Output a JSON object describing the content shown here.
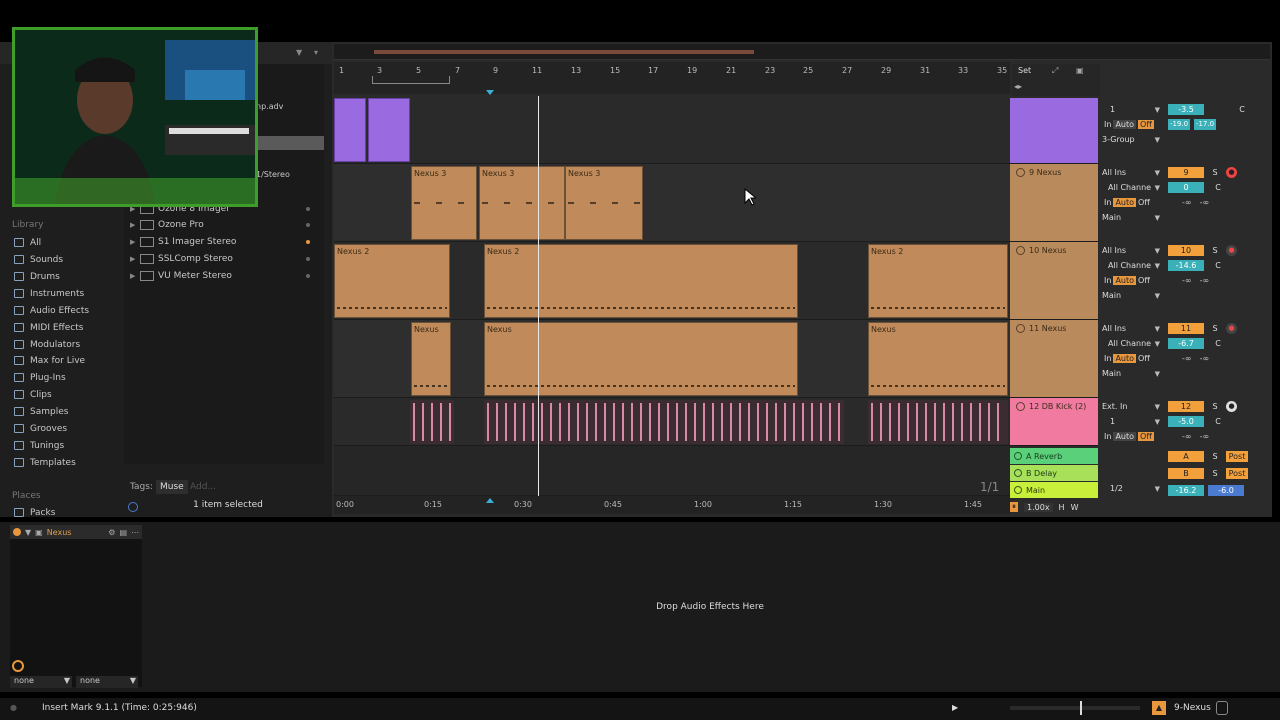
{
  "browser": {
    "file_fragments": {
      "advanced": "np.adv",
      "stereo": "1/Stereo"
    },
    "plugins": [
      {
        "label": "Ozone 8 Imager"
      },
      {
        "label": "Ozone Pro"
      },
      {
        "label": "S1 Imager Stereo"
      },
      {
        "label": "SSLComp Stereo"
      },
      {
        "label": "VU Meter Stereo"
      }
    ],
    "library_heading": "Library",
    "library_items": [
      "All",
      "Sounds",
      "Drums",
      "Instruments",
      "Audio Effects",
      "MIDI Effects",
      "Modulators",
      "Max for Live",
      "Plug-Ins",
      "Clips",
      "Samples",
      "Grooves",
      "Tunings",
      "Templates"
    ],
    "places_heading": "Places",
    "places_items": [
      "Packs"
    ],
    "tags_label": "Tags:",
    "tag_muse": "Muse",
    "tag_add": "Add...",
    "selection_status": "1 item selected"
  },
  "arrangement": {
    "bar_numbers": [
      "1",
      "3",
      "5",
      "7",
      "9",
      "11",
      "13",
      "15",
      "17",
      "19",
      "21",
      "23",
      "25",
      "27",
      "29",
      "31",
      "33",
      "35"
    ],
    "set_label": "Set",
    "time_labels": [
      "0:00",
      "0:15",
      "0:30",
      "0:45",
      "1:00",
      "1:15",
      "1:30",
      "1:45"
    ],
    "page_indicator": "1/1",
    "zoom_value": "1.00x",
    "h_label": "H",
    "w_label": "W"
  },
  "tracks": {
    "t8": {
      "io_sub": "1",
      "auto": "Auto",
      "off": "Off",
      "output": "3-Group",
      "vol": "-3.5",
      "vol2": "-19.0",
      "vol3": "-17.0",
      "pan": "C"
    },
    "t9": {
      "name": "9 Nexus",
      "input": "All Ins",
      "channel": "All Channe",
      "in": "In",
      "auto": "Auto",
      "off": "Off",
      "output": "Main",
      "num": "9",
      "solo": "S",
      "vol": "0",
      "pan": "C",
      "inf1": "-∞",
      "inf2": "-∞",
      "clip_label": "Nexus 3"
    },
    "t10": {
      "name": "10 Nexus",
      "input": "All Ins",
      "channel": "All Channe",
      "in": "In",
      "auto": "Auto",
      "off": "Off",
      "output": "Main",
      "num": "10",
      "solo": "S",
      "vol": "-14.6",
      "pan": "C",
      "inf1": "-∞",
      "inf2": "-∞",
      "clip_label": "Nexus 2"
    },
    "t11": {
      "name": "11 Nexus",
      "input": "All Ins",
      "channel": "All Channe",
      "in": "In",
      "auto": "Auto",
      "off": "Off",
      "output": "Main",
      "num": "11",
      "solo": "S",
      "vol": "-6.7",
      "pan": "C",
      "inf1": "-∞",
      "inf2": "-∞",
      "clip_label": "Nexus"
    },
    "t12": {
      "name": "12 DB Kick (2)",
      "input": "Ext. In",
      "sub": "1",
      "in": "In",
      "auto": "Auto",
      "off": "Off",
      "num": "12",
      "solo": "S",
      "vol": "-5.0",
      "pan": "C",
      "inf1": "-∞",
      "inf2": "-∞"
    },
    "returns": [
      {
        "name": "A Reverb",
        "num": "A",
        "solo": "S",
        "post": "Post",
        "color": "#5ad07a"
      },
      {
        "name": "B Delay",
        "num": "B",
        "solo": "S",
        "post": "Post",
        "color": "#a8e05a"
      }
    ],
    "main": {
      "name": "Main",
      "sub": "1/2",
      "vol": "-16.2",
      "vol2": "-6.0",
      "color": "#c8f03a"
    }
  },
  "device": {
    "title": "Nexus",
    "drop_hint": "Drop Audio Effects Here",
    "select_left": "none",
    "select_right": "none"
  },
  "status_bar": {
    "message": "Insert Mark 9.1.1 (Time: 0:25:946)",
    "selected_track": "9-Nexus"
  }
}
